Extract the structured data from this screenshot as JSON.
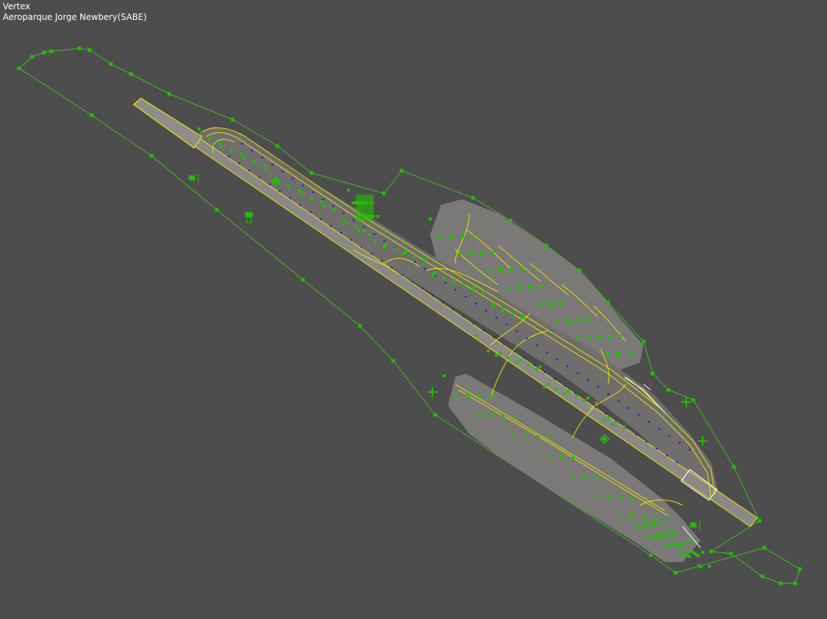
{
  "hud": {
    "mode": "Vertex",
    "airport": "Aeroparque Jorge Newbery(SABE)"
  },
  "colors": {
    "background": "#4e4d4d",
    "boundary": "#3fbf1f",
    "vertex": "#22c000",
    "pavement": "#7a7978",
    "runway": "#8a8988",
    "taxiline": "#e8e800",
    "edge_light": "#1a1ad0",
    "white_marking": "#ffffff"
  },
  "icons": {
    "vertex": "green-square-vertex-icon",
    "sign": "taxiway-sign-icon",
    "tower": "tower-icon",
    "windsock": "windsock-icon",
    "beacon": "beacon-icon"
  }
}
